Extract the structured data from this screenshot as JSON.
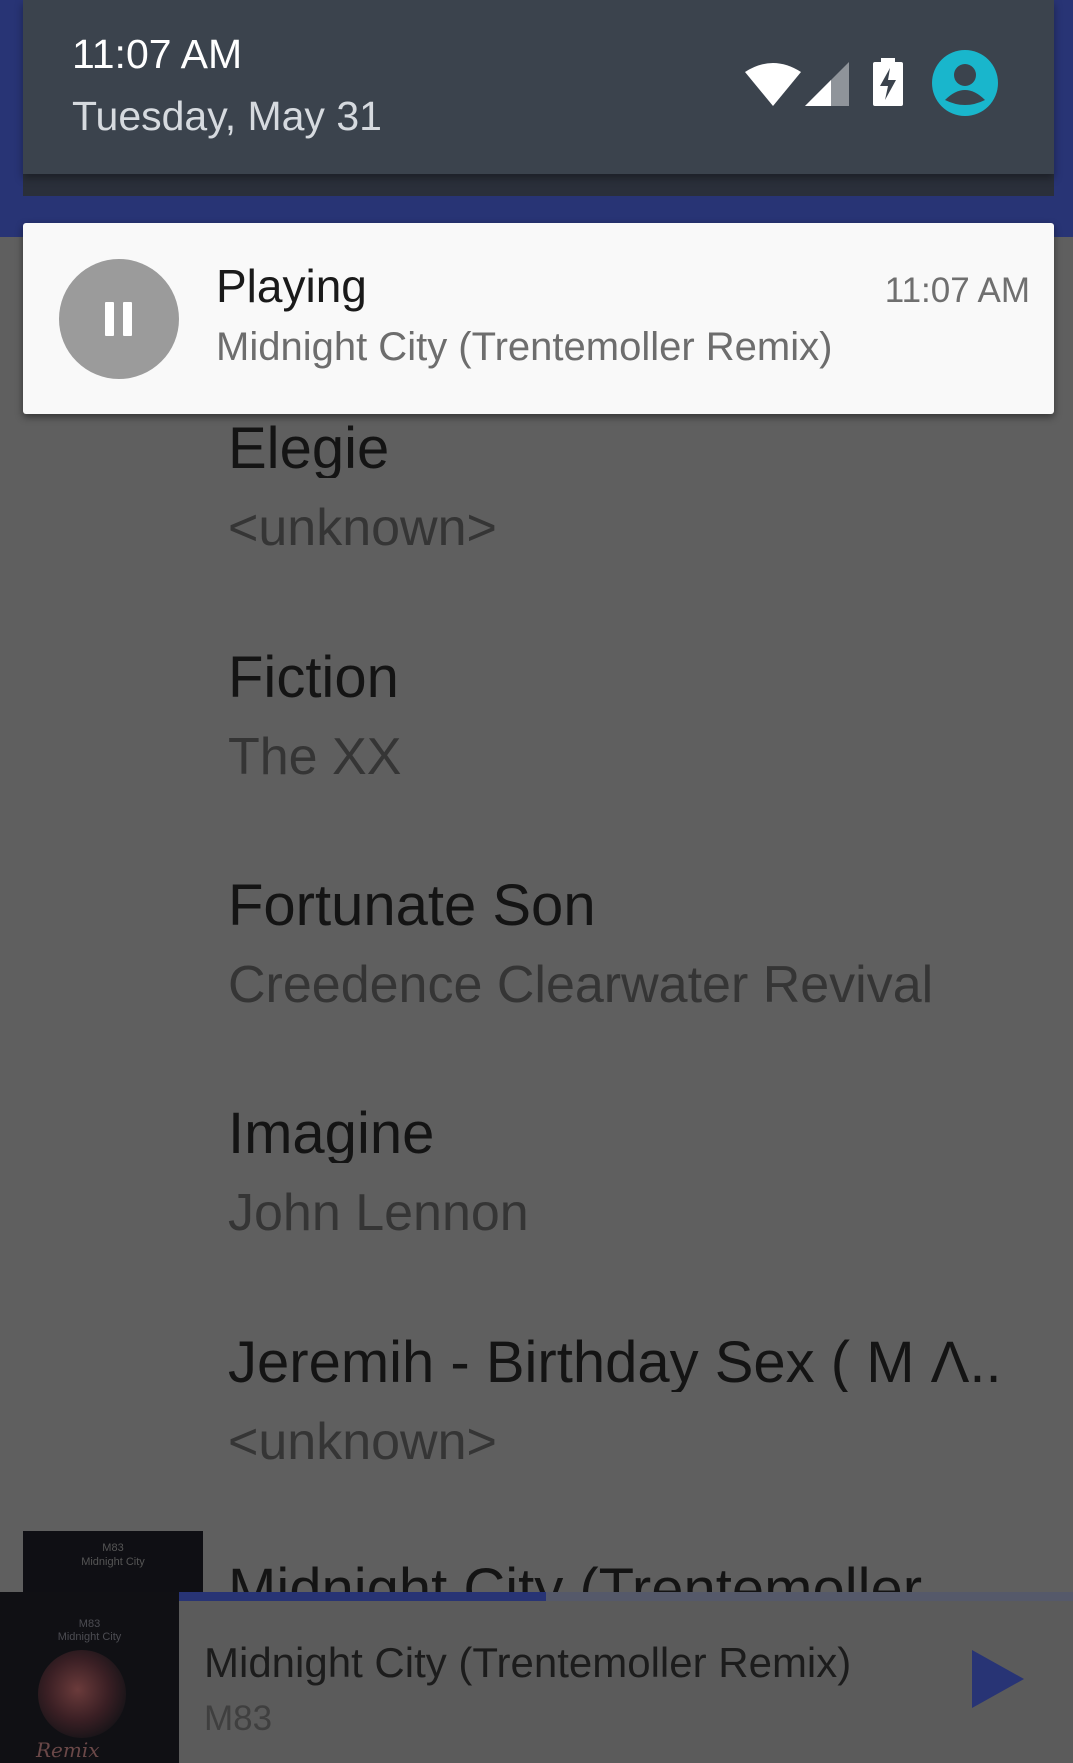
{
  "status": {
    "time": "11:07 AM",
    "date": "Tuesday, May 31",
    "icons": [
      "wifi-icon",
      "cell-signal-icon",
      "battery-charging-icon",
      "account-icon"
    ],
    "accent": "#19b6cc"
  },
  "notification": {
    "icon": "pause-icon",
    "title": "Playing",
    "text": "Midnight City (Trentemoller Remix)",
    "time": "11:07 AM"
  },
  "songs": [
    {
      "title": "Elegie",
      "artist": "<unknown>"
    },
    {
      "title": "Fiction",
      "artist": "The XX"
    },
    {
      "title": "Fortunate Son",
      "artist": "Creedence Clearwater Revival"
    },
    {
      "title": "Imagine",
      "artist": "John Lennon"
    },
    {
      "title": "Jeremih - Birthday Sex ( M Λ..",
      "artist": "<unknown>"
    },
    {
      "title": "Midnight City (Trentemoller",
      "artist": ""
    }
  ],
  "album_thumb_text": [
    "M83",
    "Midnight City"
  ],
  "player": {
    "title": "Midnight City (Trentemoller Remix)",
    "artist": "M83",
    "cover_text": [
      "M83",
      "Midnight City",
      "Remix"
    ],
    "progress": 0.41,
    "play_icon": "play-icon"
  },
  "colors": {
    "app_primary": "#283475",
    "shade_header": "#3b434d",
    "scrim": "#5f5f5f"
  }
}
